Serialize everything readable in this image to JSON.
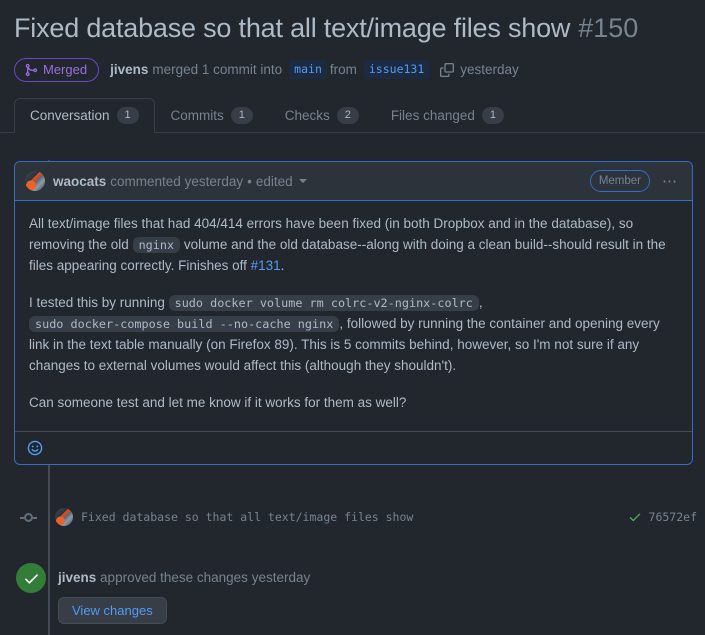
{
  "header": {
    "title": "Fixed database so that all text/image files show",
    "number": "#150",
    "state_badge": "Merged",
    "merge_icon": "git-merge-icon",
    "author": "jivens",
    "merged_text": "merged 1 commit into",
    "base_branch": "main",
    "from_text": "from",
    "head_branch": "issue131",
    "copy_icon": "copy-icon",
    "timestamp": "yesterday"
  },
  "tabs": [
    {
      "label": "Conversation",
      "count": "1",
      "active": true
    },
    {
      "label": "Commits",
      "count": "1",
      "active": false
    },
    {
      "label": "Checks",
      "count": "2",
      "active": false
    },
    {
      "label": "Files changed",
      "count": "1",
      "active": false
    }
  ],
  "comment": {
    "avatar": "avatar",
    "user": "waocats",
    "meta": "commented yesterday",
    "separator": "•",
    "edited": "edited",
    "caret_icon": "chevron-down-icon",
    "badge": "Member",
    "kebab_icon": "kebab-horizontal-icon",
    "paragraphs": {
      "p1_a": "All text/image files that had 404/414 errors have been fixed (in both Dropbox and in the database), so removing the old ",
      "p1_code": "nginx",
      "p1_b": " volume and the old database--along with doing a clean build--should result in the files appearing correctly. Finishes off ",
      "p1_link": "#131",
      "p1_c": ".",
      "p2_a": "I tested this by running ",
      "p2_code1": "sudo docker volume rm colrc-v2-nginx-colrc",
      "p2_b": ", ",
      "p2_code2": "sudo docker-compose build --no-cache nginx",
      "p2_c": ", followed by running the container and opening every link in the text table manually (on Firefox 89). This is 5 commits behind, however, so I'm not sure if any changes to external volumes would affect this (although they shouldn't).",
      "p3": "Can someone test and let me know if it works for them as well?"
    },
    "reaction_icon": "smiley-icon"
  },
  "commit": {
    "avatar": "avatar",
    "message": "Fixed database so that all text/image files show",
    "check_icon": "check-icon",
    "sha": "76572ef"
  },
  "approval": {
    "check_icon": "check-circle-icon",
    "user": "jivens",
    "text": "approved these changes",
    "timestamp": "yesterday",
    "button_label": "View changes"
  },
  "colors": {
    "background": "#22272e",
    "merged_purple": "#986ee2",
    "link_blue": "#539bf5",
    "approve_green": "#347d39",
    "check_green": "#57ab5a",
    "border": "#373e47",
    "muted_text": "#768390",
    "body_text": "#adbac7"
  }
}
